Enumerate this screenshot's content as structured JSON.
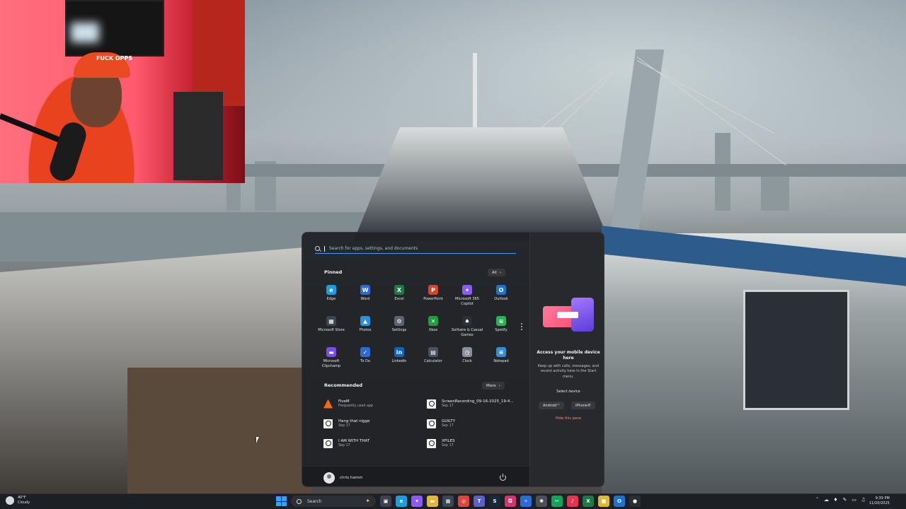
{
  "webcam": {
    "cap_text": "FUCK OPPS"
  },
  "start_menu": {
    "search_placeholder": "Search for apps, settings, and documents",
    "pinned": {
      "title": "Pinned",
      "all_label": "All",
      "apps": [
        {
          "name": "Edge",
          "icon": "edge-icon",
          "color": "#1b9de2",
          "glyph": "e"
        },
        {
          "name": "Word",
          "icon": "word-icon",
          "color": "#2b6bd6",
          "glyph": "W"
        },
        {
          "name": "Excel",
          "icon": "excel-icon",
          "color": "#1d7a45",
          "glyph": "X"
        },
        {
          "name": "PowerPoint",
          "icon": "powerpoint-icon",
          "color": "#d2462a",
          "glyph": "P"
        },
        {
          "name": "Microsoft 365 Copilot",
          "icon": "copilot-icon",
          "color": "#8a5cf5",
          "glyph": "✦"
        },
        {
          "name": "Outlook",
          "icon": "outlook-icon",
          "color": "#1a73d0",
          "glyph": "O"
        },
        {
          "name": "Microsoft Store",
          "icon": "store-icon",
          "color": "#3c4552",
          "glyph": "▦"
        },
        {
          "name": "Photos",
          "icon": "photos-icon",
          "color": "#2f8fd8",
          "glyph": "▲"
        },
        {
          "name": "Settings",
          "icon": "gear-icon",
          "color": "#5d6470",
          "glyph": "⚙"
        },
        {
          "name": "Xbox",
          "icon": "xbox-icon",
          "color": "#1f9e3e",
          "glyph": "✕"
        },
        {
          "name": "Solitaire & Casual Games",
          "icon": "solitaire-icon",
          "color": "#2a2f38",
          "glyph": "♠"
        },
        {
          "name": "Spotify",
          "icon": "spotify-icon",
          "color": "#1db954",
          "glyph": "≋"
        },
        {
          "name": "Microsoft Clipchamp",
          "icon": "clipchamp-icon",
          "color": "#7a4be8",
          "glyph": "▬"
        },
        {
          "name": "To Do",
          "icon": "todo-icon",
          "color": "#2b6bd6",
          "glyph": "✓"
        },
        {
          "name": "LinkedIn",
          "icon": "linkedin-icon",
          "color": "#0a66c2",
          "glyph": "in"
        },
        {
          "name": "Calculator",
          "icon": "calculator-icon",
          "color": "#4a5260",
          "glyph": "▤"
        },
        {
          "name": "Clock",
          "icon": "clock-icon",
          "color": "#8a8f99",
          "glyph": "◷"
        },
        {
          "name": "Notepad",
          "icon": "notepad-icon",
          "color": "#2d8fe0",
          "glyph": "≡"
        }
      ]
    },
    "recommended": {
      "title": "Recommended",
      "more_label": "More",
      "items": [
        {
          "name": "FiveM",
          "sub": "Frequently used app",
          "icon": "fivem-icon"
        },
        {
          "name": "ScreenRecording_09-16-2025_19-4...",
          "sub": "Sep 17",
          "icon": "file-icon"
        },
        {
          "name": "Hang that nigge",
          "sub": "Sep 17",
          "icon": "file-icon"
        },
        {
          "name": "GUILTY",
          "sub": "Sep 17",
          "icon": "file-icon"
        },
        {
          "name": "I AM WITH THAT",
          "sub": "Sep 17",
          "icon": "file-icon"
        },
        {
          "name": "XFILES",
          "sub": "Sep 17",
          "icon": "file-icon"
        }
      ]
    },
    "user": {
      "name": "chris hamm"
    },
    "phone_link": {
      "title": "Access your mobile device here",
      "desc": "Keep up with calls, messages, and recent activity here in the Start menu.",
      "select_label": "Select device",
      "android_label": "Android™",
      "iphone_label": "iPhone®",
      "hide_label": "Hide this pane"
    }
  },
  "taskbar": {
    "weather_temp": "40°F",
    "weather_cond": "Cloudy",
    "search_label": "Search",
    "apps": [
      {
        "icon": "task-view-icon",
        "color": "#3b4150",
        "glyph": "▣"
      },
      {
        "icon": "edge-icon",
        "color": "#1b9de2",
        "glyph": "e"
      },
      {
        "icon": "copilot-icon",
        "color": "#8a5cf5",
        "glyph": "✦"
      },
      {
        "icon": "file-explorer-icon",
        "color": "#e7b53b",
        "glyph": "▬"
      },
      {
        "icon": "store-icon",
        "color": "#3c4552",
        "glyph": "▦"
      },
      {
        "icon": "chrome-icon",
        "color": "#d9473b",
        "glyph": "◎"
      },
      {
        "icon": "teams-icon",
        "color": "#5b5fc7",
        "glyph": "T"
      },
      {
        "icon": "steam-icon",
        "color": "#1b2838",
        "glyph": "S"
      },
      {
        "icon": "instagram-icon",
        "color": "#d6336c",
        "glyph": "◘"
      },
      {
        "icon": "copilot-app-icon",
        "color": "#2b6bd6",
        "glyph": "✧"
      },
      {
        "icon": "chatgpt-icon",
        "color": "#4a4f58",
        "glyph": "✺"
      },
      {
        "icon": "capcut-icon",
        "color": "#14a35a",
        "glyph": "✂"
      },
      {
        "icon": "tiktok-icon",
        "color": "#e8324f",
        "glyph": "♪"
      },
      {
        "icon": "excel-icon",
        "color": "#1d7a45",
        "glyph": "X"
      },
      {
        "icon": "sticky-notes-icon",
        "color": "#e0b92a",
        "glyph": "■"
      },
      {
        "icon": "outlook-icon",
        "color": "#1a73d0",
        "glyph": "O"
      },
      {
        "icon": "obs-icon",
        "color": "#2a2d33",
        "glyph": "●"
      }
    ],
    "clock_time": "9:39 PM",
    "clock_date": "11/20/2025"
  }
}
